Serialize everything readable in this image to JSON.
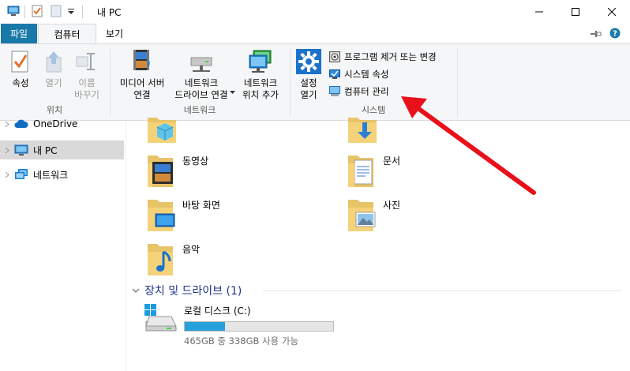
{
  "window": {
    "title": "내 PC"
  },
  "tabs": [
    {
      "label": "파일"
    },
    {
      "label": "컴퓨터"
    },
    {
      "label": "보기"
    }
  ],
  "ribbon": {
    "location": {
      "label": "위치",
      "properties": "속성",
      "open": "열기",
      "rename_line1": "이름",
      "rename_line2": "바꾸기"
    },
    "network": {
      "label": "네트워크",
      "media_line1": "미디어 서버",
      "media_line2": "연결",
      "map_line1": "네트워크",
      "map_line2": "드라이브 연결",
      "add_line1": "네트워크",
      "add_line2": "위치 추가"
    },
    "system": {
      "label": "시스템",
      "settings_line1": "설정",
      "settings_line2": "열기",
      "uninstall": "프로그램 제거 또는 변경",
      "sys_props": "시스템 속성",
      "manage": "컴퓨터 관리"
    }
  },
  "nav": {
    "items": [
      {
        "label": "OneDrive"
      },
      {
        "label": "내 PC"
      },
      {
        "label": "네트워크"
      }
    ]
  },
  "folders": [
    {
      "label": "동영상"
    },
    {
      "label": "문서"
    },
    {
      "label": "바탕 화면"
    },
    {
      "label": "사진"
    },
    {
      "label": "음악"
    }
  ],
  "devices": {
    "header": "장치 및 드라이브 (1)",
    "drive": {
      "name": "로컬 디스크 (C:)",
      "free_text": "465GB 중 338GB 사용 가능",
      "used_fraction": 0.273
    }
  },
  "colors": {
    "accent": "#1979a9",
    "drive_fill": "#26a0da",
    "arrow": "#e8101a",
    "section": "#1e3287"
  }
}
